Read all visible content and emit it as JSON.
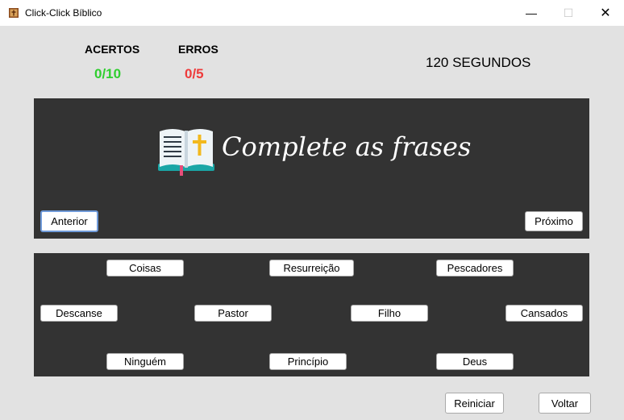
{
  "window": {
    "title": "Click-Click Bíblico",
    "minimize_glyph": "—",
    "maximize_glyph": "☐",
    "close_glyph": "✕",
    "icon": "bible-icon"
  },
  "score": {
    "hits_label": "ACERTOS",
    "hits_value": "0/10",
    "errors_label": "ERROS",
    "errors_value": "0/5",
    "timer": "120 SEGUNDOS"
  },
  "header_panel": {
    "heading": "Complete as frases",
    "icon": "open-bible-icon",
    "prev_label": "Anterior",
    "next_label": "Próximo"
  },
  "word_buttons": [
    "Coisas",
    "Resurreição",
    "Pescadores",
    "Descanse",
    "Pastor",
    "Filho",
    "Cansados",
    "Ninguém",
    "Princípio",
    "Deus"
  ],
  "footer": {
    "restart_label": "Reiniciar",
    "back_label": "Voltar"
  },
  "colors": {
    "hits": "#2fce2f",
    "errors": "#ee3b3b",
    "panel": "#333333",
    "background": "#e2e2e2"
  }
}
